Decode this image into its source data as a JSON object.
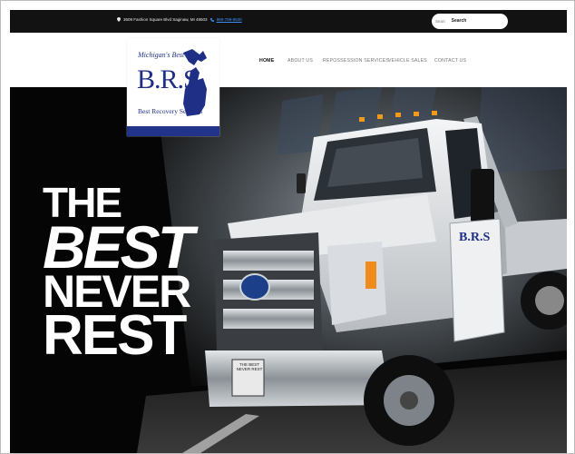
{
  "topbar": {
    "address": "3609 Fashion Square Blvd Saginaw, MI 48603",
    "phone": "989-799-8530",
    "search_placeholder": "Search ...",
    "search_button": "Search"
  },
  "logo": {
    "tagline": "Michigan's Best",
    "initials": "B.R.S",
    "company": "Best Recovery Services"
  },
  "nav": {
    "items": [
      {
        "label": "HOME",
        "active": true
      },
      {
        "label": "ABOUT US",
        "active": false
      },
      {
        "label": "REPOSSESSION SERVICES",
        "active": false
      },
      {
        "label": "VEHICLE SALES",
        "active": false
      },
      {
        "label": "CONTACT US",
        "active": false
      }
    ]
  },
  "hero": {
    "line1": "THE",
    "line2": "BEST",
    "line3": "NEVER",
    "line4": "REST",
    "truck_door_text": "B.R.S",
    "plate_text": "THE BEST NEVER REST"
  },
  "colors": {
    "brand_blue": "#1f2f86",
    "topbar_bg": "#121212",
    "link_blue": "#3f8ef7"
  }
}
